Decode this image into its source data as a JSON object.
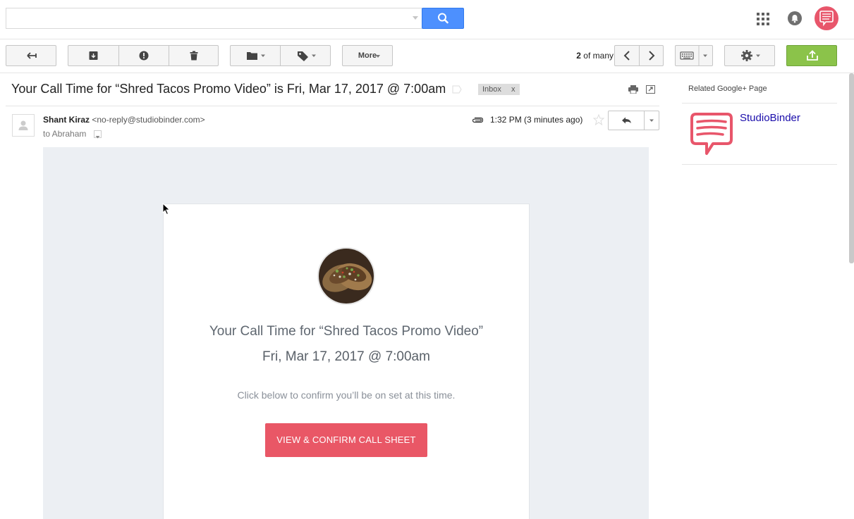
{
  "search": {
    "placeholder": "",
    "value": ""
  },
  "toolbar": {
    "more_label": "More"
  },
  "pager": {
    "current": "2",
    "of": "of",
    "total": "many"
  },
  "subject": "Your Call Time for “Shred Tacos Promo Video” is Fri, Mar 17, 2017 @ 7:00am",
  "label_chip": {
    "name": "Inbox",
    "remove": "x"
  },
  "message": {
    "sender_name": "Shant Kiraz",
    "sender_email": "<no-reply@studiobinder.com>",
    "to": "to Abraham",
    "time": "1:32 PM (3 minutes ago)"
  },
  "email_body": {
    "title": "Your Call Time for “Shred Tacos Promo Video”",
    "date": "Fri, Mar 17, 2017 @ 7:00am",
    "instructions": "Click below to confirm you’ll be on set at this time.",
    "button": "VIEW & CONFIRM CALL SHEET"
  },
  "right_panel": {
    "related_label": "Related Google+ Page",
    "page_name": "StudioBinder"
  },
  "colors": {
    "brand_red": "#e95766",
    "search_blue": "#4d90fe",
    "compose_green": "#8bc34a",
    "link_blue": "#1a0dab"
  }
}
